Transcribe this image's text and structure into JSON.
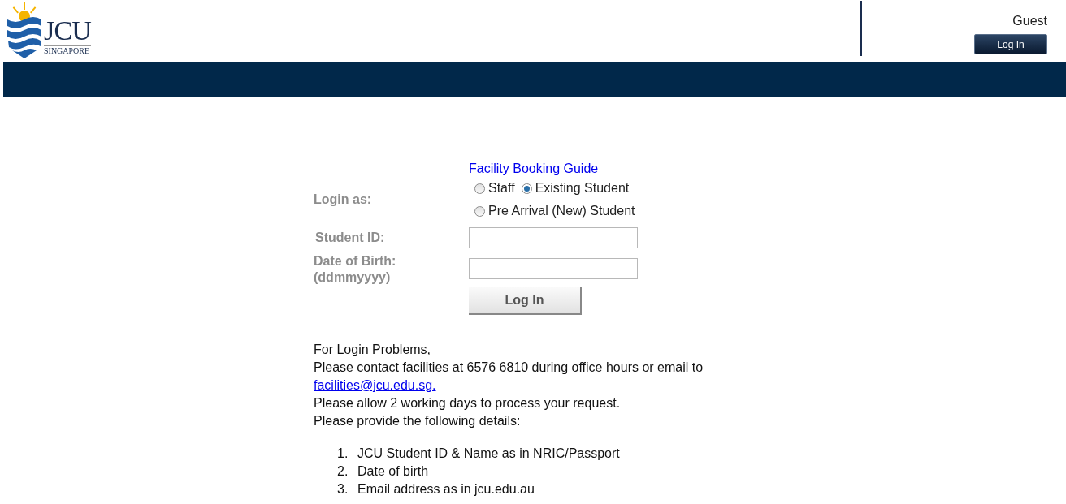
{
  "header": {
    "logo": {
      "name": "JCU",
      "subtitle": "SINGAPORE"
    },
    "user": "Guest",
    "login_button": "Log In"
  },
  "form": {
    "guide_link": "Facility Booking Guide",
    "login_as_label": "Login as:",
    "radio_rows": [
      [
        {
          "label": "Staff",
          "selected": false
        },
        {
          "label": "Existing Student",
          "selected": true
        }
      ],
      [
        {
          "label": "Pre Arrival (New) Student",
          "selected": false
        }
      ]
    ],
    "fields": [
      {
        "label": "Student ID:"
      },
      {
        "label": "Date of Birth:",
        "hint": "(ddmmyyyy)"
      }
    ],
    "submit": "Log In"
  },
  "help": {
    "heading": "For Login Problems,",
    "contact": "Please contact facilities at 6576 6810 during office hours or email to",
    "email": "facilities@jcu.edu.sg.",
    "notes": [
      "Please allow 2 working days to process your request.",
      "Please provide the following details:"
    ],
    "details": [
      {
        "number": "1.",
        "text": "JCU Student ID & Name as in NRIC/Passport"
      },
      {
        "number": "2.",
        "text": "Date of birth"
      },
      {
        "number": "3.",
        "text": "Email address as in jcu.edu.au"
      }
    ]
  }
}
